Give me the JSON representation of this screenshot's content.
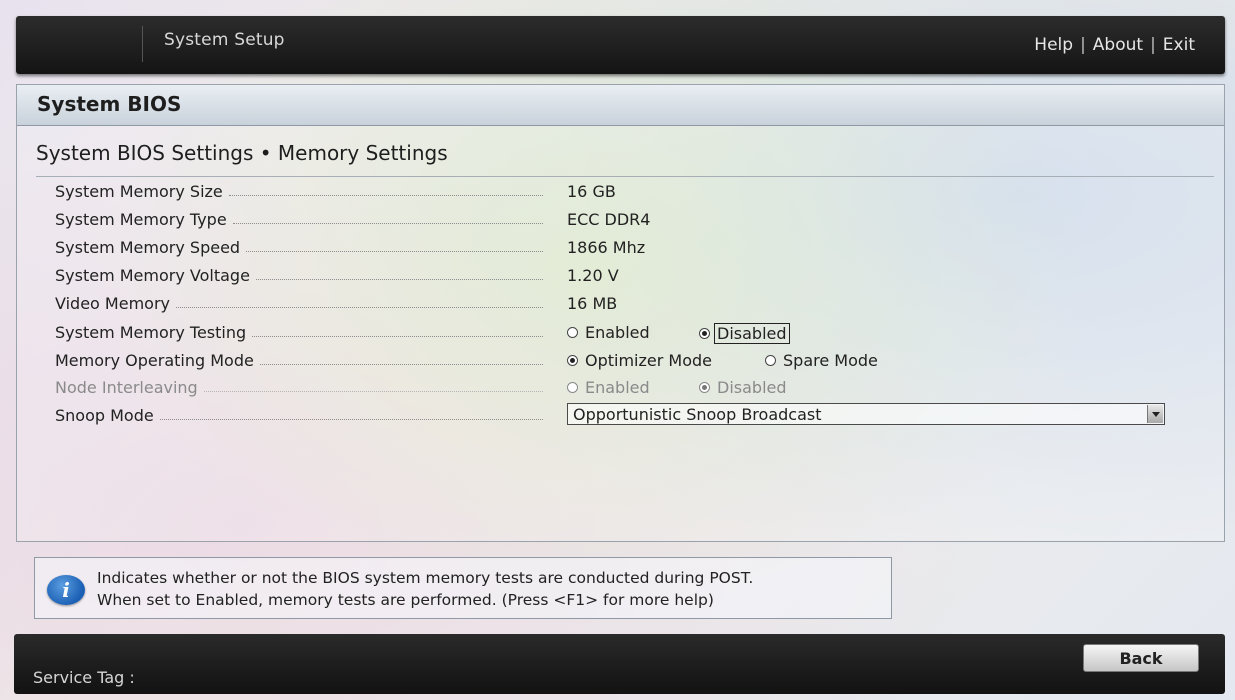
{
  "header": {
    "title": "System Setup",
    "links": [
      "Help",
      "About",
      "Exit"
    ],
    "separator": "|"
  },
  "panel": {
    "title": "System BIOS",
    "section_title": "System BIOS Settings • Memory Settings"
  },
  "settings": {
    "memory_size": {
      "label": "System Memory Size",
      "value": "16 GB"
    },
    "memory_type": {
      "label": "System Memory Type",
      "value": "ECC DDR4"
    },
    "memory_speed": {
      "label": "System Memory Speed",
      "value": "1866 Mhz"
    },
    "memory_voltage": {
      "label": "System Memory Voltage",
      "value": "1.20 V"
    },
    "video_memory": {
      "label": "Video Memory",
      "value": "16 MB"
    },
    "memory_testing": {
      "label": "System Memory Testing",
      "options": [
        "Enabled",
        "Disabled"
      ],
      "selected": "Disabled"
    },
    "operating_mode": {
      "label": "Memory Operating Mode",
      "options": [
        "Optimizer Mode",
        "Spare Mode"
      ],
      "selected": "Optimizer Mode"
    },
    "node_interleaving": {
      "label": "Node Interleaving",
      "options": [
        "Enabled",
        "Disabled"
      ],
      "selected": "Disabled",
      "state": "disabled"
    },
    "snoop_mode": {
      "label": "Snoop Mode",
      "value": "Opportunistic Snoop Broadcast"
    }
  },
  "help": {
    "icon": "info-icon",
    "line1": "Indicates whether or not the BIOS system memory tests are conducted during POST.",
    "line2": "When set to Enabled, memory tests are performed. (Press <F1> for more help)"
  },
  "footer": {
    "service_tag_label": "Service Tag :",
    "back_label": "Back"
  },
  "colors": {
    "bar_bg": "#1c1c1c",
    "info_blue": "#1a5fb4",
    "disabled_text": "#8a8a8a"
  }
}
